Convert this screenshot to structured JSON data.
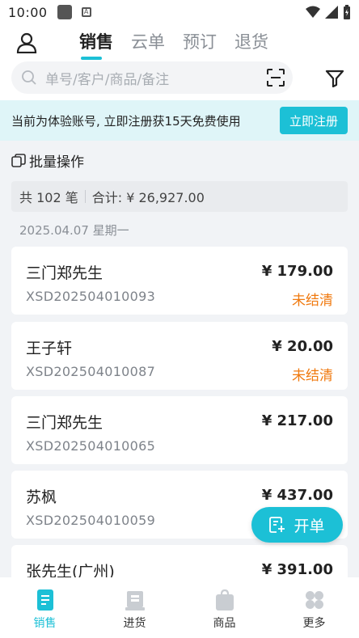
{
  "statusbar": {
    "time": "10:00",
    "notif_icon_letter": "A"
  },
  "header": {
    "tabs": [
      {
        "label": "销售",
        "active": true
      },
      {
        "label": "云单",
        "active": false
      },
      {
        "label": "预订",
        "active": false
      },
      {
        "label": "退货",
        "active": false
      }
    ],
    "search_placeholder": "单号/客户/商品/备注"
  },
  "banner": {
    "text": "当前为体验账号, 立即注册获15天免费使用",
    "button": "立即注册"
  },
  "batch_label": "批量操作",
  "summary": {
    "count": "共 102 笔",
    "total": "合计: ¥ 26,927.00"
  },
  "date_header": "2025.04.07 星期一",
  "orders": [
    {
      "name": "三门郑先生",
      "no": "XSD202504010093",
      "amount": "¥ 179.00",
      "status": "未结清"
    },
    {
      "name": "王子轩",
      "no": "XSD202504010087",
      "amount": "¥ 20.00",
      "status": "未结清"
    },
    {
      "name": "三门郑先生",
      "no": "XSD202504010065",
      "amount": "¥ 217.00",
      "status": ""
    },
    {
      "name": "苏枫",
      "no": "XSD202504010059",
      "amount": "¥ 437.00",
      "status": ""
    },
    {
      "name": "张先生(广州)",
      "no": "",
      "amount": "¥ 391.00",
      "status": ""
    }
  ],
  "fab_label": "开单",
  "bottomnav": [
    {
      "label": "销售",
      "icon": "document-icon",
      "active": true
    },
    {
      "label": "进货",
      "icon": "inbound-box-icon",
      "active": false
    },
    {
      "label": "商品",
      "icon": "bag-icon",
      "active": false
    },
    {
      "label": "更多",
      "icon": "more-grid-icon",
      "active": false
    }
  ],
  "colors": {
    "accent": "#1cc0d6",
    "warning": "#f07a10",
    "banner_bg": "#dff5f8"
  }
}
